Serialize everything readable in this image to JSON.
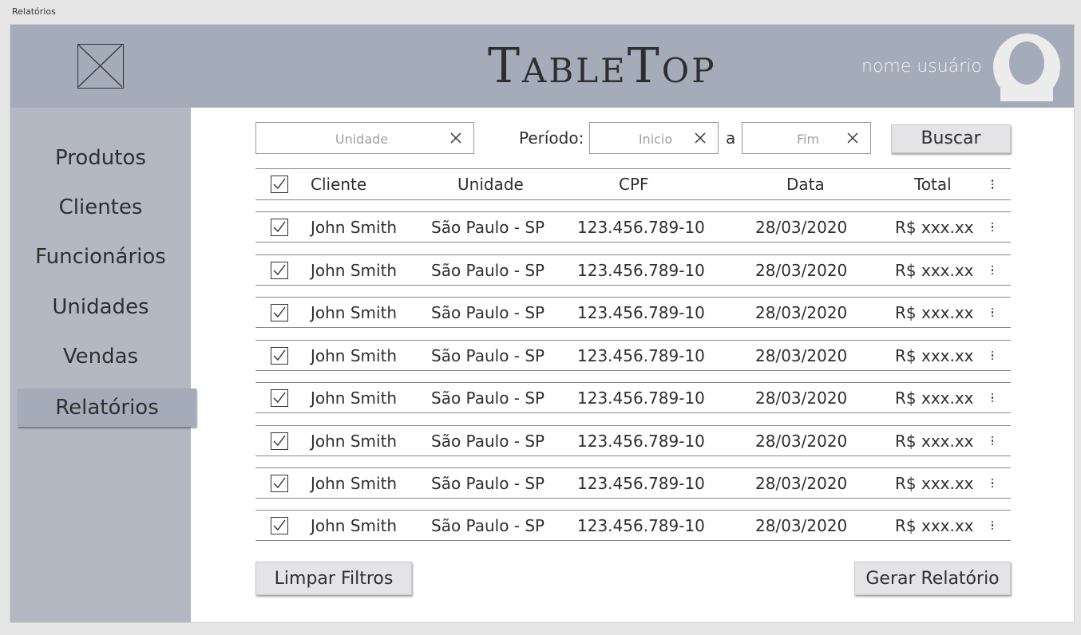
{
  "window": {
    "title": "Relatórios"
  },
  "header": {
    "brand": "TableTop",
    "username": "nome usuário",
    "logo_icon": "image-placeholder-icon",
    "avatar_icon": "user-avatar-icon"
  },
  "sidebar": {
    "items": [
      {
        "label": "Produtos"
      },
      {
        "label": "Clientes"
      },
      {
        "label": "Funcionários"
      },
      {
        "label": "Unidades"
      },
      {
        "label": "Vendas"
      },
      {
        "label": "Relatórios",
        "active": true
      }
    ]
  },
  "filters": {
    "unidade_placeholder": "Unidade",
    "periodo_label": "Período:",
    "inicio_placeholder": "Inicio",
    "range_sep": "a",
    "fim_placeholder": "Fim",
    "search_label": "Buscar"
  },
  "table": {
    "columns": [
      "Cliente",
      "Unidade",
      "CPF",
      "Data",
      "Total"
    ],
    "rows": [
      {
        "cliente": "John Smith",
        "unidade": "São Paulo - SP",
        "cpf": "123.456.789-10",
        "data": "28/03/2020",
        "total": "R$ xxx.xx"
      },
      {
        "cliente": "John Smith",
        "unidade": "São Paulo - SP",
        "cpf": "123.456.789-10",
        "data": "28/03/2020",
        "total": "R$ xxx.xx"
      },
      {
        "cliente": "John Smith",
        "unidade": "São Paulo - SP",
        "cpf": "123.456.789-10",
        "data": "28/03/2020",
        "total": "R$ xxx.xx"
      },
      {
        "cliente": "John Smith",
        "unidade": "São Paulo - SP",
        "cpf": "123.456.789-10",
        "data": "28/03/2020",
        "total": "R$ xxx.xx"
      },
      {
        "cliente": "John Smith",
        "unidade": "São Paulo - SP",
        "cpf": "123.456.789-10",
        "data": "28/03/2020",
        "total": "R$ xxx.xx"
      },
      {
        "cliente": "John Smith",
        "unidade": "São Paulo - SP",
        "cpf": "123.456.789-10",
        "data": "28/03/2020",
        "total": "R$ xxx.xx"
      },
      {
        "cliente": "John Smith",
        "unidade": "São Paulo - SP",
        "cpf": "123.456.789-10",
        "data": "28/03/2020",
        "total": "R$ xxx.xx"
      },
      {
        "cliente": "John Smith",
        "unidade": "São Paulo - SP",
        "cpf": "123.456.789-10",
        "data": "28/03/2020",
        "total": "R$ xxx.xx"
      }
    ]
  },
  "actions": {
    "clear_filters": "Limpar Filtros",
    "generate_report": "Gerar Relatório"
  },
  "colors": {
    "header_bg": "#a5acb9",
    "sidebar_bg": "#b3b8c3",
    "button_bg": "#e4e4e6"
  }
}
